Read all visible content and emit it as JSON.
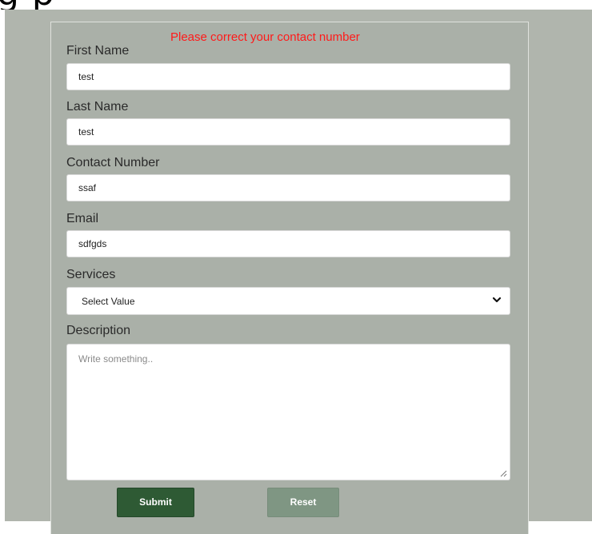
{
  "header_fragment": "g         p",
  "form": {
    "error_message": "Please correct your contact number",
    "first_name": {
      "label": "First Name",
      "value": "test"
    },
    "last_name": {
      "label": "Last Name",
      "value": "test"
    },
    "contact_number": {
      "label": "Contact Number",
      "value": "ssaf"
    },
    "email": {
      "label": "Email",
      "value": "sdfgds"
    },
    "services": {
      "label": "Services",
      "selected": "Select Value"
    },
    "description": {
      "label": "Description",
      "placeholder": "Write something.."
    },
    "submit_label": "Submit",
    "reset_label": "Reset"
  },
  "colors": {
    "page_background": "#b0b5ad",
    "error": "#ff1a1a",
    "submit": "#2e5a34",
    "reset": "#7f9683"
  },
  "icons": {
    "select": "chevron-down-icon",
    "textarea": "resize-handle-icon"
  }
}
